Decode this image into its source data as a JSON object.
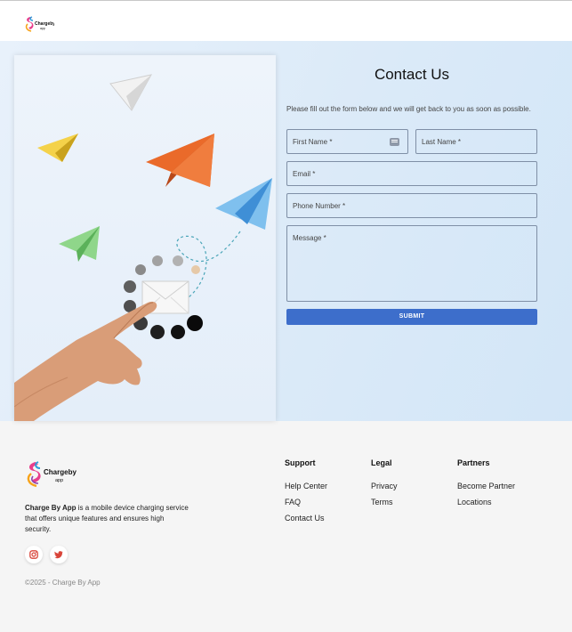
{
  "header": {
    "logo_icon": "chargeby-logo-icon"
  },
  "contact": {
    "title": "Contact Us",
    "subtitle": "Please fill out the form below and we will get back to you as soon as possible.",
    "fields": {
      "first_name": "First Name *",
      "last_name": "Last Name *",
      "email": "Email *",
      "phone": "Phone Number *",
      "message": "Message *"
    },
    "submit_label": "SUBMIT"
  },
  "footer": {
    "brand_name": "Charge By App",
    "description_rest": " is a mobile device charging service that offers unique features and ensures high security.",
    "social": [
      "instagram-icon",
      "twitter-icon"
    ],
    "copyright": "©2025 - Charge By App",
    "columns": [
      {
        "title": "Support",
        "links": [
          "Help Center",
          "FAQ",
          "Contact Us"
        ]
      },
      {
        "title": "Legal",
        "links": [
          "Privacy",
          "Terms"
        ]
      },
      {
        "title": "Partners",
        "links": [
          "Become Partner",
          "Locations"
        ]
      }
    ]
  },
  "colors": {
    "accent": "#3d6ecb",
    "hero_bg": "#dbeaf8",
    "footer_bg": "#f5f5f5",
    "social_red": "#d9453a"
  }
}
